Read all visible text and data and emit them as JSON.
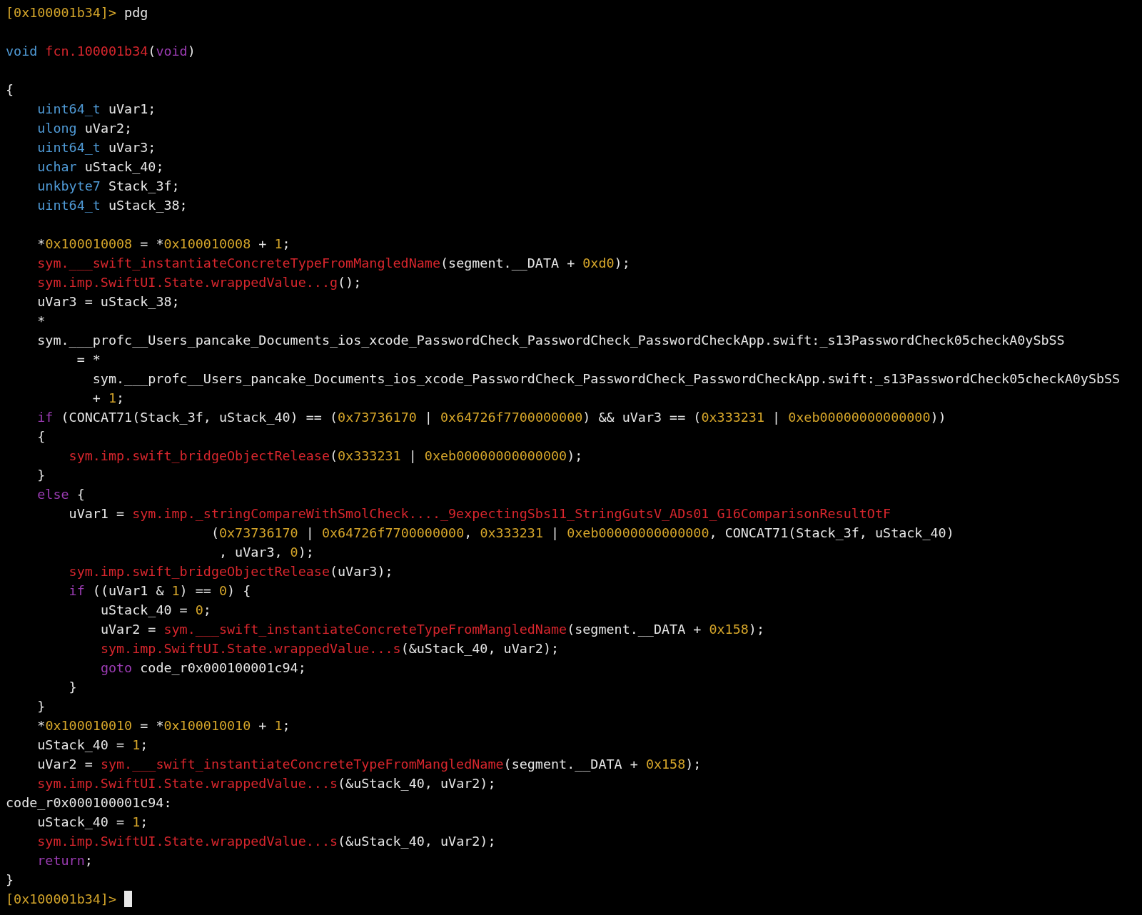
{
  "terminal": {
    "lines": [
      {
        "kind": "code",
        "segments": [
          {
            "kind": "prompt",
            "text": "[0x100001b34]>"
          },
          {
            "kind": "plain",
            "text": " pdg"
          }
        ]
      },
      {
        "kind": "blank"
      },
      {
        "kind": "code",
        "segments": [
          {
            "kind": "type",
            "text": "void"
          },
          {
            "kind": "func",
            "text": " fcn.100001b34"
          },
          {
            "kind": "plain",
            "text": "("
          },
          {
            "kind": "keyword",
            "text": "void"
          },
          {
            "kind": "plain",
            "text": ")"
          }
        ]
      },
      {
        "kind": "blank"
      },
      {
        "kind": "code",
        "segments": [
          {
            "kind": "plain",
            "text": "{"
          }
        ]
      },
      {
        "kind": "code",
        "segments": [
          {
            "kind": "type",
            "text": "    uint64_t"
          },
          {
            "kind": "plain",
            "text": " uVar1;"
          }
        ]
      },
      {
        "kind": "code",
        "segments": [
          {
            "kind": "type",
            "text": "    ulong"
          },
          {
            "kind": "plain",
            "text": " uVar2;"
          }
        ]
      },
      {
        "kind": "code",
        "segments": [
          {
            "kind": "type",
            "text": "    uint64_t"
          },
          {
            "kind": "plain",
            "text": " uVar3;"
          }
        ]
      },
      {
        "kind": "code",
        "segments": [
          {
            "kind": "type",
            "text": "    uchar"
          },
          {
            "kind": "plain",
            "text": " uStack_40;"
          }
        ]
      },
      {
        "kind": "code",
        "segments": [
          {
            "kind": "type",
            "text": "    unkbyte7"
          },
          {
            "kind": "plain",
            "text": " Stack_3f;"
          }
        ]
      },
      {
        "kind": "code",
        "segments": [
          {
            "kind": "type",
            "text": "    uint64_t"
          },
          {
            "kind": "plain",
            "text": " uStack_38;"
          }
        ]
      },
      {
        "kind": "blank"
      },
      {
        "kind": "code",
        "segments": [
          {
            "kind": "plain",
            "text": "    *"
          },
          {
            "kind": "number",
            "text": "0x100010008"
          },
          {
            "kind": "plain",
            "text": " = *"
          },
          {
            "kind": "number",
            "text": "0x100010008"
          },
          {
            "kind": "plain",
            "text": " + "
          },
          {
            "kind": "number",
            "text": "1"
          },
          {
            "kind": "plain",
            "text": ";"
          }
        ]
      },
      {
        "kind": "code",
        "segments": [
          {
            "kind": "func",
            "text": "    sym.___swift_instantiateConcreteTypeFromMangledName"
          },
          {
            "kind": "plain",
            "text": "(segment.__DATA + "
          },
          {
            "kind": "number",
            "text": "0xd0"
          },
          {
            "kind": "plain",
            "text": ");"
          }
        ]
      },
      {
        "kind": "code",
        "segments": [
          {
            "kind": "func",
            "text": "    sym.imp.SwiftUI.State.wrappedValue...g"
          },
          {
            "kind": "plain",
            "text": "();"
          }
        ]
      },
      {
        "kind": "code",
        "segments": [
          {
            "kind": "plain",
            "text": "    uVar3 = uStack_38;"
          }
        ]
      },
      {
        "kind": "code",
        "segments": [
          {
            "kind": "plain",
            "text": "    *"
          }
        ]
      },
      {
        "kind": "code",
        "segments": [
          {
            "kind": "plain",
            "text": "    sym.___profc__Users_pancake_Documents_ios_xcode_PasswordCheck_PasswordCheck_PasswordCheckApp.swift:_s13PasswordCheck05checkA0ySbSS"
          }
        ]
      },
      {
        "kind": "code",
        "segments": [
          {
            "kind": "plain",
            "text": "         = *"
          }
        ]
      },
      {
        "kind": "code",
        "segments": [
          {
            "kind": "plain",
            "text": "           sym.___profc__Users_pancake_Documents_ios_xcode_PasswordCheck_PasswordCheck_PasswordCheckApp.swift:_s13PasswordCheck05checkA0ySbSS"
          }
        ]
      },
      {
        "kind": "code",
        "segments": [
          {
            "kind": "plain",
            "text": "           + "
          },
          {
            "kind": "number",
            "text": "1"
          },
          {
            "kind": "plain",
            "text": ";"
          }
        ]
      },
      {
        "kind": "code",
        "segments": [
          {
            "kind": "keyword",
            "text": "    if"
          },
          {
            "kind": "plain",
            "text": " (CONCAT71(Stack_3f, uStack_40) == ("
          },
          {
            "kind": "number",
            "text": "0x73736170"
          },
          {
            "kind": "plain",
            "text": " | "
          },
          {
            "kind": "number",
            "text": "0x64726f7700000000"
          },
          {
            "kind": "plain",
            "text": ") && uVar3 == ("
          },
          {
            "kind": "number",
            "text": "0x333231"
          },
          {
            "kind": "plain",
            "text": " | "
          },
          {
            "kind": "number",
            "text": "0xeb00000000000000"
          },
          {
            "kind": "plain",
            "text": "))"
          }
        ]
      },
      {
        "kind": "code",
        "segments": [
          {
            "kind": "plain",
            "text": "    {"
          }
        ]
      },
      {
        "kind": "code",
        "segments": [
          {
            "kind": "func",
            "text": "        sym.imp.swift_bridgeObjectRelease"
          },
          {
            "kind": "plain",
            "text": "("
          },
          {
            "kind": "number",
            "text": "0x333231"
          },
          {
            "kind": "plain",
            "text": " | "
          },
          {
            "kind": "number",
            "text": "0xeb00000000000000"
          },
          {
            "kind": "plain",
            "text": ");"
          }
        ]
      },
      {
        "kind": "code",
        "segments": [
          {
            "kind": "plain",
            "text": "    }"
          }
        ]
      },
      {
        "kind": "code",
        "segments": [
          {
            "kind": "keyword",
            "text": "    else"
          },
          {
            "kind": "plain",
            "text": " {"
          }
        ]
      },
      {
        "kind": "code",
        "segments": [
          {
            "kind": "plain",
            "text": "        uVar1 = "
          },
          {
            "kind": "func",
            "text": "sym.imp._stringCompareWithSmolCheck...._9expectingSbs11_StringGutsV_ADs01_G16ComparisonResultOtF"
          }
        ]
      },
      {
        "kind": "code",
        "segments": [
          {
            "kind": "plain",
            "text": "                          ("
          },
          {
            "kind": "number",
            "text": "0x73736170"
          },
          {
            "kind": "plain",
            "text": " | "
          },
          {
            "kind": "number",
            "text": "0x64726f7700000000"
          },
          {
            "kind": "plain",
            "text": ", "
          },
          {
            "kind": "number",
            "text": "0x333231"
          },
          {
            "kind": "plain",
            "text": " | "
          },
          {
            "kind": "number",
            "text": "0xeb00000000000000"
          },
          {
            "kind": "plain",
            "text": ", CONCAT71(Stack_3f, uStack_40)"
          }
        ]
      },
      {
        "kind": "code",
        "segments": [
          {
            "kind": "plain",
            "text": "                           , uVar3, "
          },
          {
            "kind": "number",
            "text": "0"
          },
          {
            "kind": "plain",
            "text": ");"
          }
        ]
      },
      {
        "kind": "code",
        "segments": [
          {
            "kind": "func",
            "text": "        sym.imp.swift_bridgeObjectRelease"
          },
          {
            "kind": "plain",
            "text": "(uVar3);"
          }
        ]
      },
      {
        "kind": "code",
        "segments": [
          {
            "kind": "keyword",
            "text": "        if"
          },
          {
            "kind": "plain",
            "text": " ((uVar1 & "
          },
          {
            "kind": "number",
            "text": "1"
          },
          {
            "kind": "plain",
            "text": ") == "
          },
          {
            "kind": "number",
            "text": "0"
          },
          {
            "kind": "plain",
            "text": ") {"
          }
        ]
      },
      {
        "kind": "code",
        "segments": [
          {
            "kind": "plain",
            "text": "            uStack_40 = "
          },
          {
            "kind": "number",
            "text": "0"
          },
          {
            "kind": "plain",
            "text": ";"
          }
        ]
      },
      {
        "kind": "code",
        "segments": [
          {
            "kind": "plain",
            "text": "            uVar2 = "
          },
          {
            "kind": "func",
            "text": "sym.___swift_instantiateConcreteTypeFromMangledName"
          },
          {
            "kind": "plain",
            "text": "(segment.__DATA + "
          },
          {
            "kind": "number",
            "text": "0x158"
          },
          {
            "kind": "plain",
            "text": ");"
          }
        ]
      },
      {
        "kind": "code",
        "segments": [
          {
            "kind": "func",
            "text": "            sym.imp.SwiftUI.State.wrappedValue...s"
          },
          {
            "kind": "plain",
            "text": "(&uStack_40, uVar2);"
          }
        ]
      },
      {
        "kind": "code",
        "segments": [
          {
            "kind": "keyword",
            "text": "            goto"
          },
          {
            "kind": "plain",
            "text": " code_r0x000100001c94;"
          }
        ]
      },
      {
        "kind": "code",
        "segments": [
          {
            "kind": "plain",
            "text": "        }"
          }
        ]
      },
      {
        "kind": "code",
        "segments": [
          {
            "kind": "plain",
            "text": "    }"
          }
        ]
      },
      {
        "kind": "code",
        "segments": [
          {
            "kind": "plain",
            "text": "    *"
          },
          {
            "kind": "number",
            "text": "0x100010010"
          },
          {
            "kind": "plain",
            "text": " = *"
          },
          {
            "kind": "number",
            "text": "0x100010010"
          },
          {
            "kind": "plain",
            "text": " + "
          },
          {
            "kind": "number",
            "text": "1"
          },
          {
            "kind": "plain",
            "text": ";"
          }
        ]
      },
      {
        "kind": "code",
        "segments": [
          {
            "kind": "plain",
            "text": "    uStack_40 = "
          },
          {
            "kind": "number",
            "text": "1"
          },
          {
            "kind": "plain",
            "text": ";"
          }
        ]
      },
      {
        "kind": "code",
        "segments": [
          {
            "kind": "plain",
            "text": "    uVar2 = "
          },
          {
            "kind": "func",
            "text": "sym.___swift_instantiateConcreteTypeFromMangledName"
          },
          {
            "kind": "plain",
            "text": "(segment.__DATA + "
          },
          {
            "kind": "number",
            "text": "0x158"
          },
          {
            "kind": "plain",
            "text": ");"
          }
        ]
      },
      {
        "kind": "code",
        "segments": [
          {
            "kind": "func",
            "text": "    sym.imp.SwiftUI.State.wrappedValue...s"
          },
          {
            "kind": "plain",
            "text": "(&uStack_40, uVar2);"
          }
        ]
      },
      {
        "kind": "code",
        "segments": [
          {
            "kind": "plain",
            "text": "code_r0x000100001c94:"
          }
        ]
      },
      {
        "kind": "code",
        "segments": [
          {
            "kind": "plain",
            "text": "    uStack_40 = "
          },
          {
            "kind": "number",
            "text": "1"
          },
          {
            "kind": "plain",
            "text": ";"
          }
        ]
      },
      {
        "kind": "code",
        "segments": [
          {
            "kind": "func",
            "text": "    sym.imp.SwiftUI.State.wrappedValue...s"
          },
          {
            "kind": "plain",
            "text": "(&uStack_40, uVar2);"
          }
        ]
      },
      {
        "kind": "code",
        "segments": [
          {
            "kind": "keyword",
            "text": "    return"
          },
          {
            "kind": "plain",
            "text": ";"
          }
        ]
      },
      {
        "kind": "code",
        "segments": [
          {
            "kind": "plain",
            "text": "}"
          }
        ]
      },
      {
        "kind": "code",
        "cursor": true,
        "segments": [
          {
            "kind": "prompt",
            "text": "[0x100001b34]>"
          }
        ]
      }
    ]
  }
}
